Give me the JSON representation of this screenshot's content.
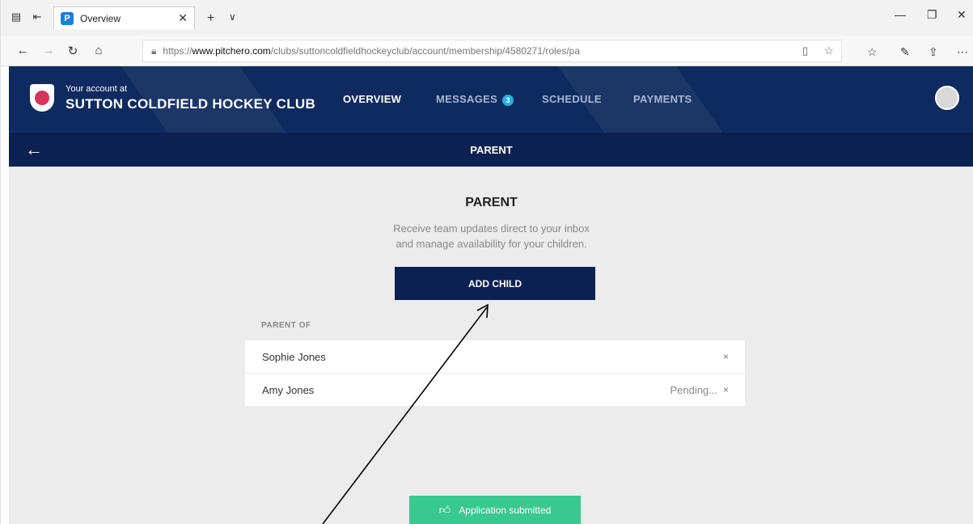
{
  "browser": {
    "tab_title": "Overview",
    "url_prefix": "https://",
    "url_host": "www.pitchero.com",
    "url_path": "/clubs/suttoncoldfieldhockeyclub/account/membership/4580271/roles/pa"
  },
  "header": {
    "account_label": "Your account at",
    "club_name": "SUTTON COLDFIELD HOCKEY CLUB",
    "nav": {
      "overview": "OVERVIEW",
      "messages": "MESSAGES",
      "messages_count": "3",
      "schedule": "SCHEDULE",
      "payments": "PAYMENTS"
    }
  },
  "subbar": {
    "title": "PARENT"
  },
  "main": {
    "heading": "PARENT",
    "description_line1": "Receive team updates direct to your inbox",
    "description_line2": "and manage availability for your children.",
    "add_child_label": "ADD CHILD",
    "parent_of_label": "PARENT OF",
    "children": [
      {
        "name": "Sophie Jones",
        "status": ""
      },
      {
        "name": "Amy Jones",
        "status": "Pending..."
      }
    ],
    "remove_symbol": "×"
  },
  "toast": {
    "text": "Application submitted"
  },
  "colors": {
    "brand_navy": "#0e2a5e",
    "success_green": "#38c98e",
    "badge_blue": "#24b1e3"
  }
}
